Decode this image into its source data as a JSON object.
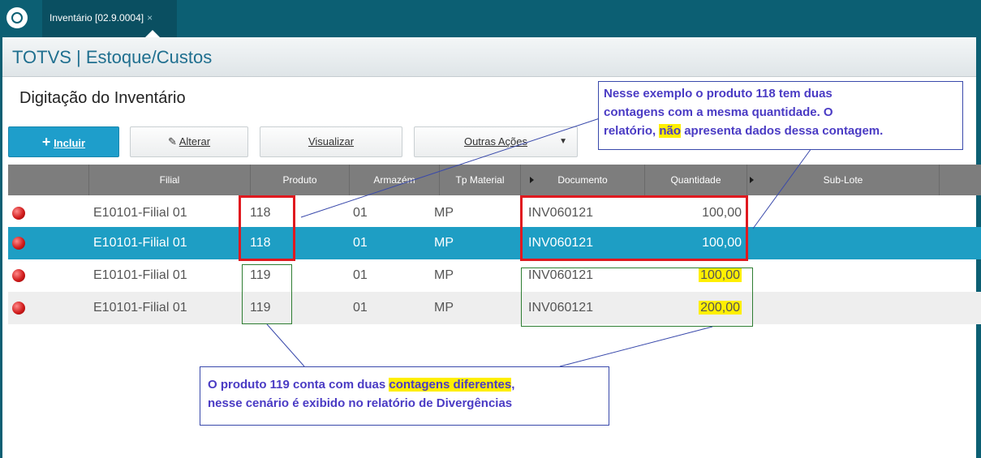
{
  "window": {
    "tab_label": "Inventário [02.9.0004]",
    "tab_close": "×"
  },
  "header": {
    "title": "TOTVS | Estoque/Custos"
  },
  "page": {
    "title": "Digitação do Inventário"
  },
  "toolbar": {
    "incluir": "Incluir",
    "alterar": "Alterar",
    "visualizar": "Visualizar",
    "outras": "Outras Ações"
  },
  "table": {
    "columns": [
      "Filial",
      "Produto",
      "Armazém",
      "Tp Material",
      "Documento",
      "Quantidade",
      "Sub-Lote"
    ],
    "rows": [
      {
        "filial": "E10101-Filial 01",
        "produto": "118",
        "armazem": "01",
        "tp": "MP",
        "doc": "INV060121",
        "qtd": "100,00"
      },
      {
        "filial": "E10101-Filial 01",
        "produto": "118",
        "armazem": "01",
        "tp": "MP",
        "doc": "INV060121",
        "qtd": "100,00"
      },
      {
        "filial": "E10101-Filial 01",
        "produto": "119",
        "armazem": "01",
        "tp": "MP",
        "doc": "INV060121",
        "qtd": "100,00"
      },
      {
        "filial": "E10101-Filial 01",
        "produto": "119",
        "armazem": "01",
        "tp": "MP",
        "doc": "INV060121",
        "qtd": "200,00"
      }
    ]
  },
  "notes": {
    "top": {
      "l1": "Nesse exemplo o produto 118 tem duas",
      "l2": "contagens com a mesma quantidade. O",
      "l3a": "relatório, ",
      "l3b": "não",
      "l3c": " apresenta dados dessa contagem."
    },
    "bottom": {
      "l1a": "O produto 119 conta com duas ",
      "l1b": "contagens diferentes",
      "l1c": ",",
      "l2": "nesse cenário é exibido no relatório de Divergências"
    }
  },
  "colors": {
    "accent": "#1e9ecb",
    "selected_row": "#1e9ec4",
    "annotation_red": "#e0191f",
    "annotation_green": "#2e7d32",
    "highlight": "#ffef00",
    "note_text": "#4a3bc4"
  }
}
